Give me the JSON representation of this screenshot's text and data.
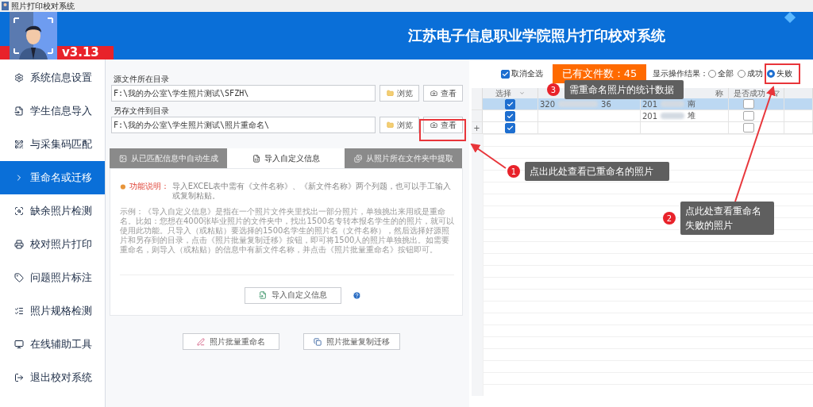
{
  "window": {
    "title": "照片打印校对系统"
  },
  "header": {
    "version": "v3.13",
    "title": "江苏电子信息职业学院照片打印校对系统"
  },
  "sidebar": {
    "items": [
      {
        "label": "系统信息设置",
        "selected": false
      },
      {
        "label": "学生信息导入",
        "selected": false
      },
      {
        "label": "与采集码匹配",
        "selected": false
      },
      {
        "label": "重命名或迁移",
        "selected": true
      },
      {
        "label": "缺余照片检测",
        "selected": false
      },
      {
        "label": "校对照片打印",
        "selected": false
      },
      {
        "label": "问题照片标注",
        "selected": false
      },
      {
        "label": "照片规格检测",
        "selected": false
      },
      {
        "label": "在线辅助工具",
        "selected": false
      },
      {
        "label": "退出校对系统",
        "selected": false
      }
    ]
  },
  "paths": [
    {
      "label": "源文件所在目录",
      "value": "F:\\我的办公室\\学生照片测试\\SFZH\\",
      "browse": "浏览",
      "view": "查看"
    },
    {
      "label": "另存文件到目录",
      "value": "F:\\我的办公室\\学生照片测试\\照片重命名\\",
      "browse": "浏览",
      "view": "查看"
    }
  ],
  "tabs": [
    {
      "label": "从已匹配信息中自动生成",
      "selected": false
    },
    {
      "label": "导入自定义信息",
      "selected": true
    },
    {
      "label": "从照片所在文件夹中提取",
      "selected": false
    }
  ],
  "description": {
    "heading": "功能说明：",
    "text": "导入EXCEL表中需有《文件名称》、《新文件名称》两个列题，也可以手工输入或复制粘贴。",
    "example": "示例：《导入自定义信息》是指在一个照片文件夹里找出一部分照片，单独挑出来用或是重命名。比如：您想在4000张毕业照片的文件夹中，找出1500名专转本报名学生的的照片，就可以使用此功能。只导入（或粘贴）要选择的1500名学生的照片名（文件名称），然后选择好源照片和另存到的目录，点击《照片批量复制迁移》按钮，即可将1500人的照片单独挑出。如需要重命名，则导入（或粘贴）的信息中有新文件名称，并点击《照片批量重命名》按钮即可。"
  },
  "import_button": "导入自定义信息",
  "actions": [
    "照片批量重命名",
    "照片批量复制迁移"
  ],
  "toolbar": {
    "deselect_all": {
      "label": "取消全选",
      "checked": true
    },
    "file_count": "已有文件数：45",
    "result_label": "显示操作结果：",
    "results": [
      {
        "label": "全部",
        "selected": false
      },
      {
        "label": "成功",
        "selected": false
      },
      {
        "label": "失败",
        "selected": true
      }
    ]
  },
  "table": {
    "columns": {
      "select": "选择",
      "name": "称",
      "success": "是否成功"
    },
    "rows": [
      {
        "selected": true,
        "checked": true,
        "code": "320",
        "code_tail": "36",
        "name": "201",
        "name_tail": "南",
        "success": false
      },
      {
        "selected": false,
        "checked": true,
        "name": "201",
        "name_tail": "堆",
        "success": false
      },
      {
        "selected": false,
        "checked": true,
        "marker": "+",
        "success": false
      }
    ]
  },
  "annotations": [
    {
      "number": "3",
      "text": "需重命名照片的统计数据"
    },
    {
      "number": "1",
      "text": "点出此处查看已重命名的照片"
    },
    {
      "number": "2",
      "text": "点此处查看重命名失败的照片"
    }
  ]
}
